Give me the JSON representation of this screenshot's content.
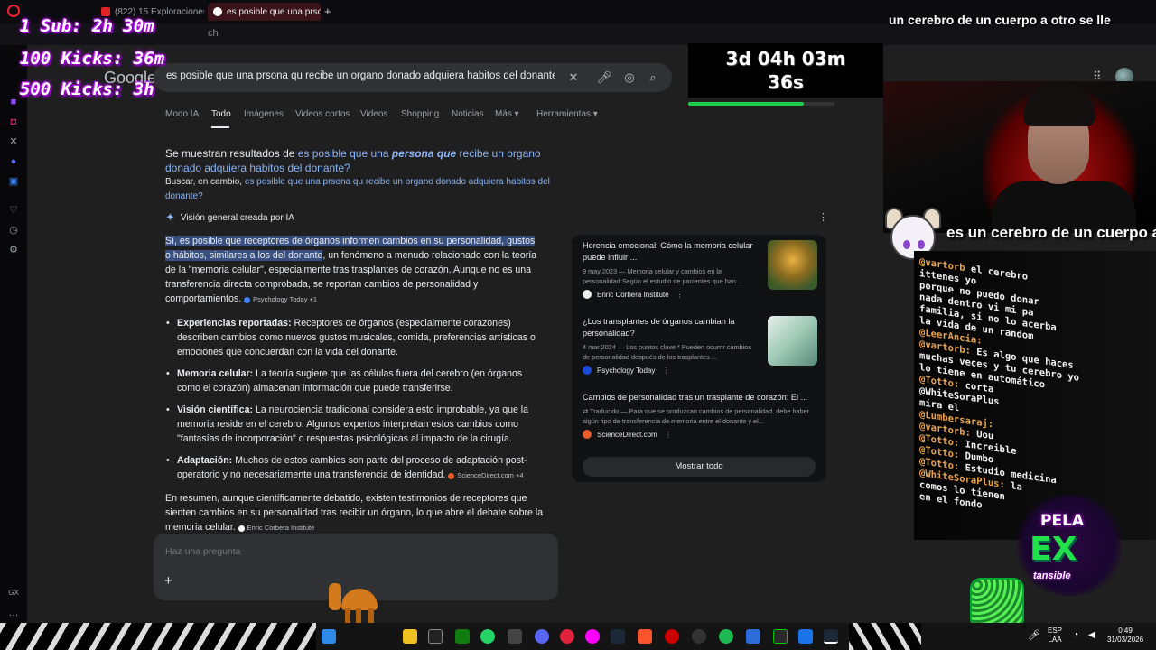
{
  "browser": {
    "tabs": [
      {
        "label": "(822) 15 Exploraciones Ult",
        "active": false
      },
      {
        "label": "es posible que una prsona",
        "active": true
      }
    ],
    "address_hint": "ch"
  },
  "search": {
    "logo": "Google",
    "query": "es posible que una prsona qu recibe un organo donado adquiera habitos del donante?",
    "tabs": [
      "Modo IA",
      "Todo",
      "Imágenes",
      "Videos cortos",
      "Videos",
      "Shopping",
      "Noticias",
      "Más",
      "Herramientas"
    ],
    "active_tab": "Todo"
  },
  "correction": {
    "prefix": "Se muestran resultados de ",
    "link_part1": "es posible que una ",
    "link_bold": "persona que",
    "link_part2": " recibe un organo donado adquiera habitos del donante?",
    "alt_prefix": "Buscar, en cambio, ",
    "alt_link": "es posible que una prsona qu recibe un organo donado adquiera habitos del donante?"
  },
  "ai_overview": {
    "header": "Visión general creada por IA",
    "intro_highlight": "Sí, es posible que receptores de órganos informen cambios en su personalidad, gustos o hábitos, similares a los del donante",
    "intro_rest": ", un fenómeno a menudo relacionado con la teoría de la \"memoria celular\", especialmente tras trasplantes de corazón. Aunque no es una transferencia directa comprobada, se reportan cambios de personalidad y comportamientos.",
    "intro_source": "Psychology Today +1",
    "bullets": [
      {
        "title": "Experiencias reportadas:",
        "text": " Receptores de órganos (especialmente corazones) describen cambios como nuevos gustos musicales, comida, preferencias artísticas o emociones que concuerdan con la vida del donante."
      },
      {
        "title": "Memoria celular:",
        "text": " La teoría sugiere que las células fuera del cerebro (en órganos como el corazón) almacenan información que puede transferirse."
      },
      {
        "title": "Visión científica:",
        "text": " La neurociencia tradicional considera esto improbable, ya que la memoria reside en el cerebro. Algunos expertos interpretan estos cambios como \"fantasías de incorporación\" o respuestas psicológicas al impacto de la cirugía."
      },
      {
        "title": "Adaptación:",
        "text": " Muchos de estos cambios son parte del proceso de adaptación post-operatorio y no necesariamente una transferencia de identidad.",
        "source": "ScienceDirect.com +4"
      }
    ],
    "summary": "En resumen, aunque científicamente debatido, existen testimonios de receptores que sienten cambios en su personalidad tras recibir un órgano, lo que abre el debate sobre la memoria celular.",
    "summary_source": "Enric Corbera Institute"
  },
  "sources": [
    {
      "title": "Herencia emocional: Cómo la memoria celular puede influir ...",
      "snippet": "9 may 2023 — Memoria celular y cambios en la personalidad Según el estudio de pacientes que han ...",
      "site": "Enric Corbera Institute"
    },
    {
      "title": "¿Los transplantes de órganos cambian la personalidad?",
      "snippet": "4 mar 2024 — Los puntos clave * Pueden ocurrir cambios de personalidad después de los trasplantes ...",
      "site": "Psychology Today"
    },
    {
      "title": "Cambios de personalidad tras un trasplante de corazón: El ...",
      "snippet": "Traducido — Para que se produzcan cambios de personalidad, debe haber algún tipo de transferencia de memoria entre el donante y el...",
      "site": "ScienceDirect.com"
    }
  ],
  "show_all": "Mostrar todo",
  "ask": {
    "placeholder": "Haz una pregunta"
  },
  "overlay": {
    "goals": [
      "1 Sub: 2h 30m",
      "100 Kicks: 36m",
      "500 Kicks: 3h"
    ],
    "ticker": "un cerebro de un cuerpo a otro se lle",
    "timer_line1": "3d 04h 03m",
    "timer_line2": "36s",
    "timer_progress": 0.79,
    "cam_caption": "es un cerebro de un cuerpo a",
    "chat": [
      {
        "user": "@vartorb",
        "text": " el cerebro"
      },
      {
        "user": "",
        "text": "ittenes yo"
      },
      {
        "user": "",
        "text": "porque no puedo donar"
      },
      {
        "user": "",
        "text": "nada dentro vi mi pa"
      },
      {
        "user": "",
        "text": "familia, si no lo acerba"
      },
      {
        "user": "",
        "text": "la vida de un random"
      },
      {
        "user": "@LeerAncia:",
        "text": ""
      },
      {
        "user": "@vartorb:",
        "text": " Es algo que haces"
      },
      {
        "user": "",
        "text": "muchas veces y tu cerebro yo"
      },
      {
        "user": "",
        "text": "lo tiene en automático"
      },
      {
        "user": "@Totto:",
        "text": " corta"
      },
      {
        "user": "",
        "text": "@WhiteSoraPlus"
      },
      {
        "user": "",
        "text": "mira el"
      },
      {
        "user": "@Lumbersaraj:",
        "text": ""
      },
      {
        "user": "@vartorb:",
        "text": " Uou"
      },
      {
        "user": "@Totto:",
        "text": " Increible"
      },
      {
        "user": "@Totto:",
        "text": " Dumbo"
      },
      {
        "user": "@Totto:",
        "text": " Estudio medicina"
      },
      {
        "user": "@WhiteSoraPlus:",
        "text": " la"
      },
      {
        "user": "",
        "text": "comos lo tienen"
      },
      {
        "user": "",
        "text": "en el fondo"
      }
    ],
    "brand_top": "PELA",
    "brand_mid": "EX",
    "brand_bot": "tansible"
  },
  "taskbar": {
    "lang1": "ESP",
    "lang2": "LAA",
    "time": "0:49",
    "date": "31/03/2026",
    "sidebar_label": "GX"
  }
}
